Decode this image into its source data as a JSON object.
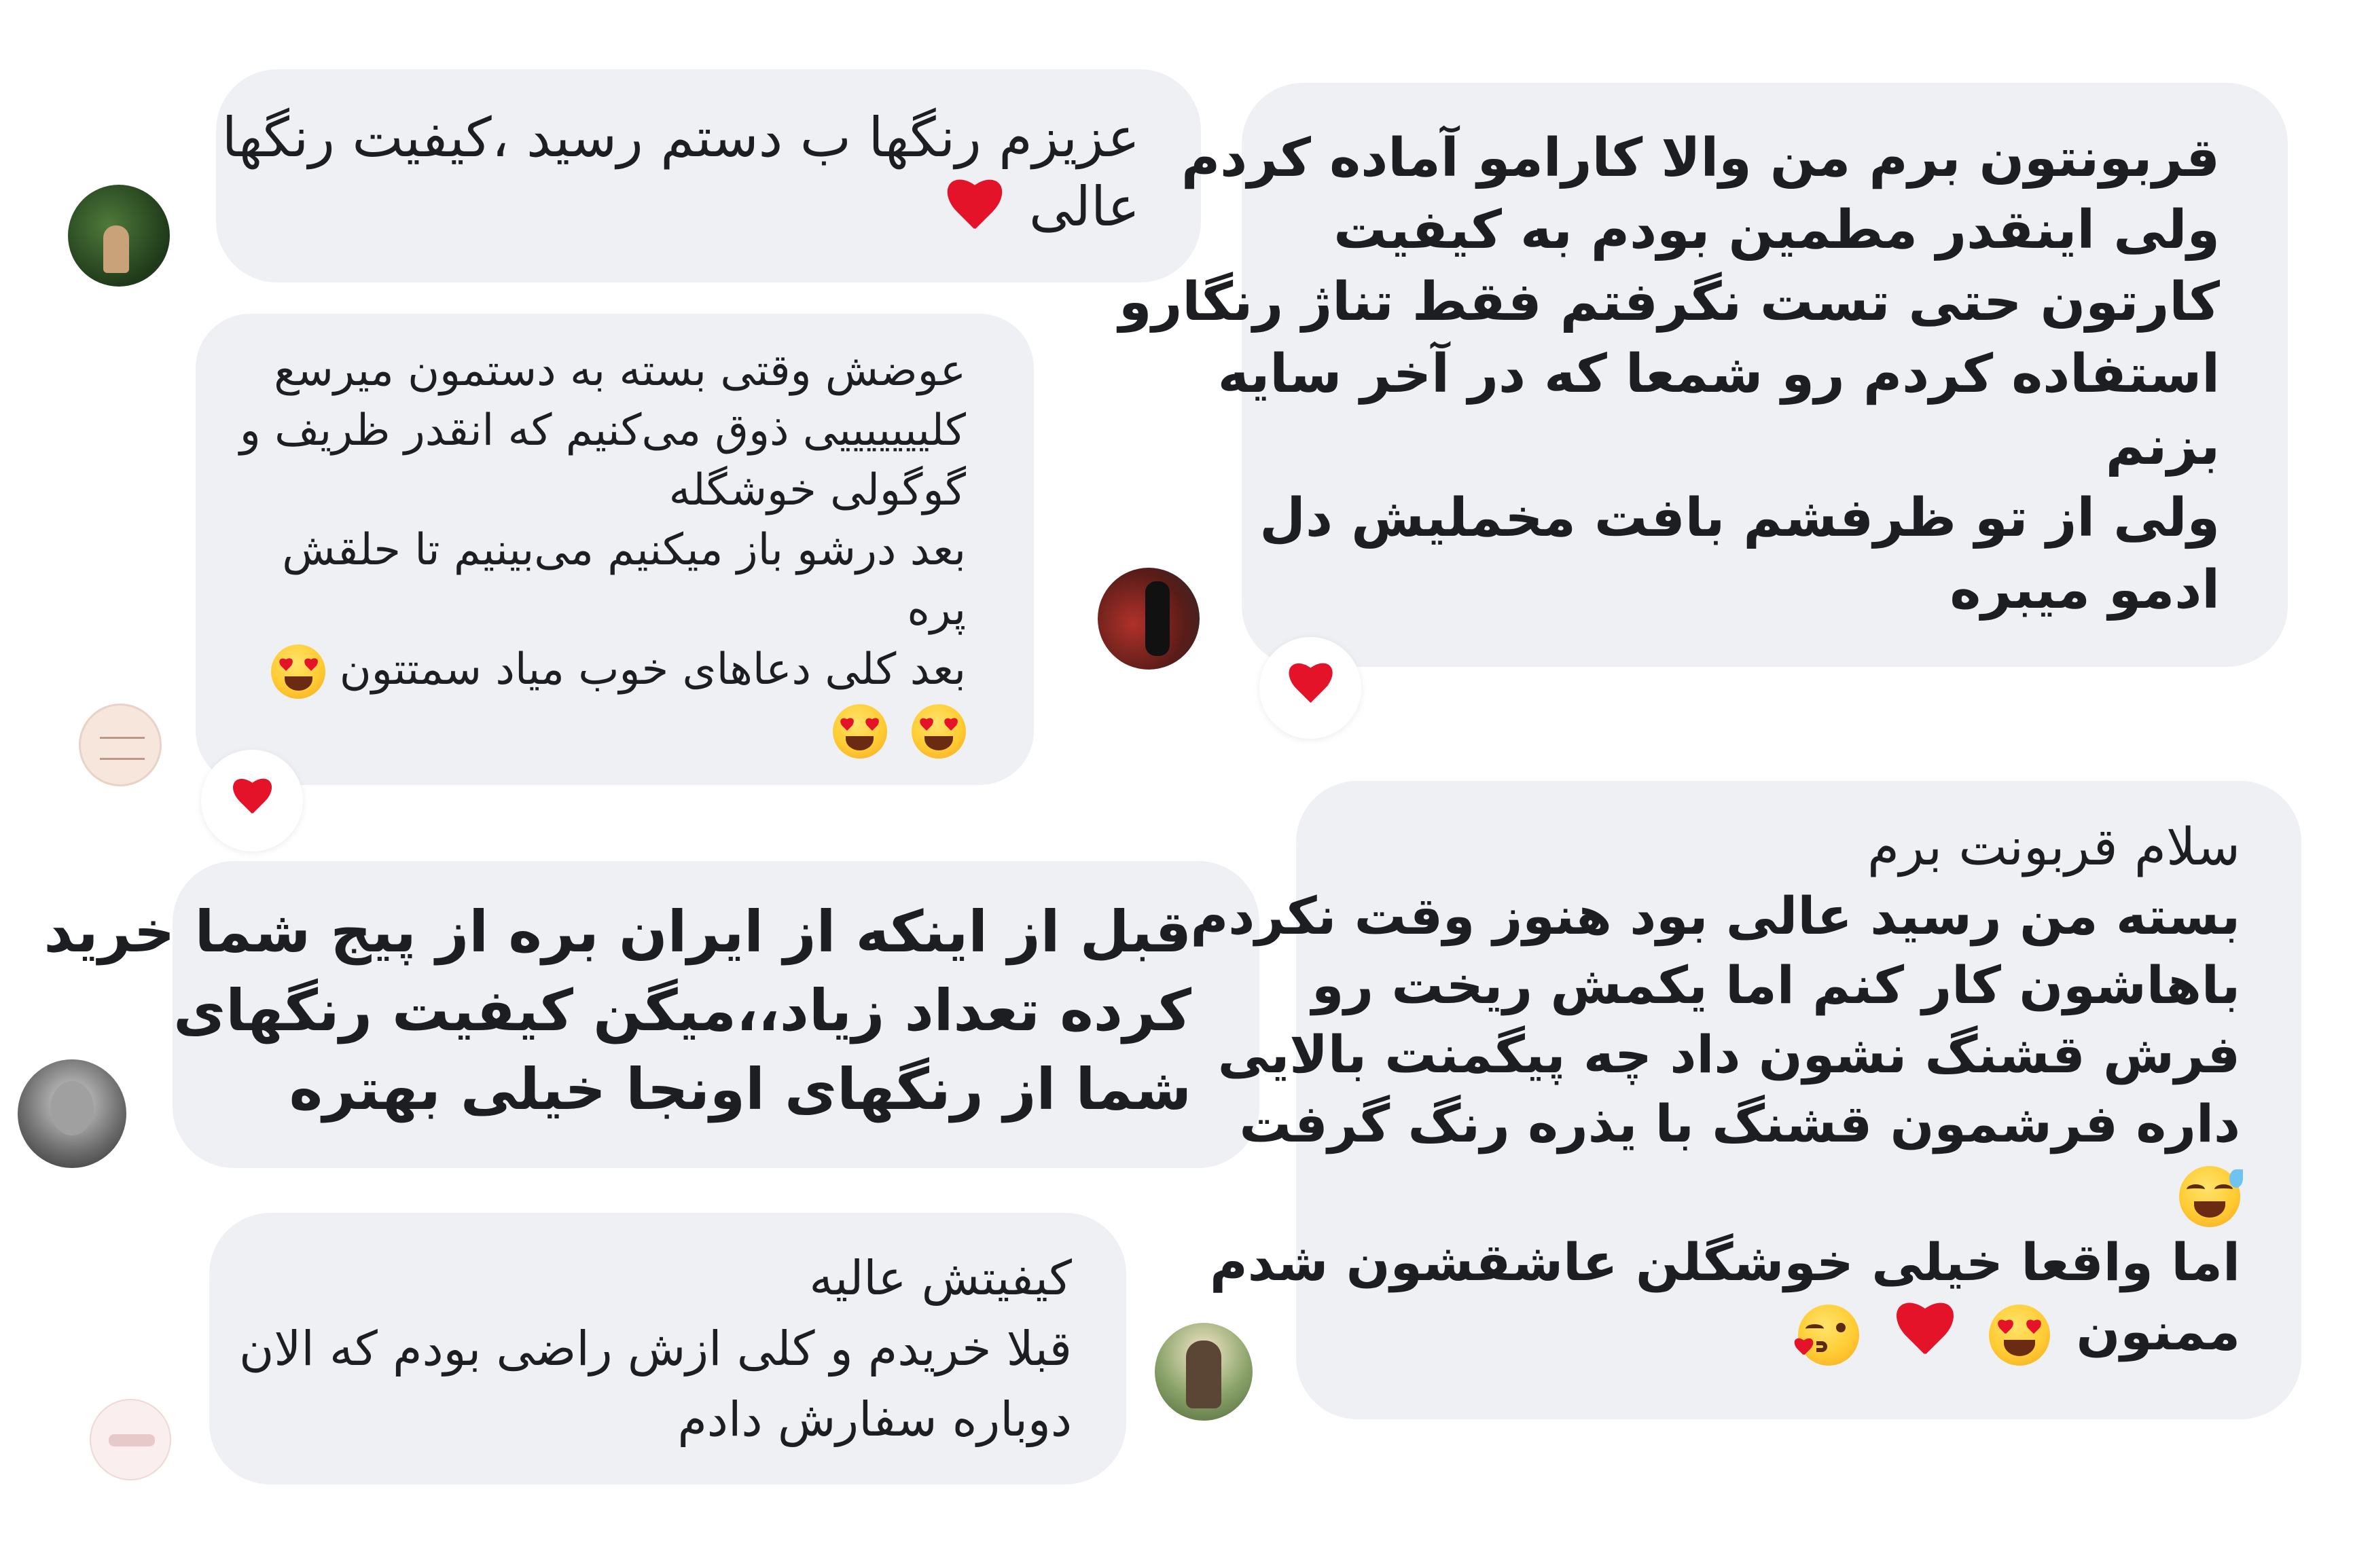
{
  "comments": [
    {
      "id": "c1",
      "lines": [
        "عزیزم رنگها ب دستم رسید ،کیفیت رنگها",
        "عالی"
      ],
      "emoji_end": [
        "red-heart"
      ]
    },
    {
      "id": "c2",
      "lines": [
        "عوضش وقتی بسته به دستمون میرسع",
        "کلیییییییی ذوق می‌کنیم که انقدر ظریف و",
        "گوگولی خوشگله",
        "بعد درشو باز میکنیم می‌بینیم تا حلقش",
        "پره",
        "بعد کلی دعاهای خوب میاد سمتتون"
      ],
      "emoji_after_last": [
        "heart-eyes"
      ],
      "emoji_line": [
        "heart-eyes",
        "heart-eyes"
      ],
      "reaction": "red-heart"
    },
    {
      "id": "c3",
      "lines": [
        "قبل از اینکه از ایران بره از پیج شما خرید",
        "کرده تعداد زیاد،،میگن کیفیت رنگهای",
        "شما از رنگهای اونجا خیلی بهتره"
      ]
    },
    {
      "id": "c4",
      "lines": [
        "کیفیتش عالیه",
        "قبلا خریدم و کلی ازش راضی بودم که الان",
        "دوباره سفارش دادم"
      ]
    },
    {
      "id": "c5",
      "lines": [
        "قربونتون برم من والا کارامو آماده کردم",
        "ولی اینقدر مطمین بودم  به کیفیت",
        "کارتون حتی تست نگرفتم فقط تناژ  رنگارو",
        "استفاده کردم رو شمعا که در آخر سایه",
        "بزنم",
        "ولی از تو  ظرفشم بافت مخملیش دل",
        "ادمو میبره"
      ],
      "reaction": "red-heart"
    },
    {
      "id": "c6",
      "lines": [
        "سلام قربونت برم",
        "بسته من رسید عالی بود هنوز وقت نکردم",
        "باهاشون کار کنم اما یکمش ریخت رو",
        "فرش قشنگ نشون داد چه پیگمنت بالایی",
        "داره فرشمون قشنگ با یذره رنگ گرفت"
      ],
      "emoji_line": [
        "grinning-sweat"
      ],
      "lines_after": [
        "اما واقعا خیلی خوشگلن عاشقشون شدم"
      ],
      "last_text": "ممنون",
      "emoji_end": [
        "heart-eyes",
        "red-heart",
        "kissing-heart"
      ]
    }
  ],
  "colors": {
    "bubble": "#eff0f3",
    "heart": "#e4132a",
    "emoji_face": "#ffcc33"
  }
}
